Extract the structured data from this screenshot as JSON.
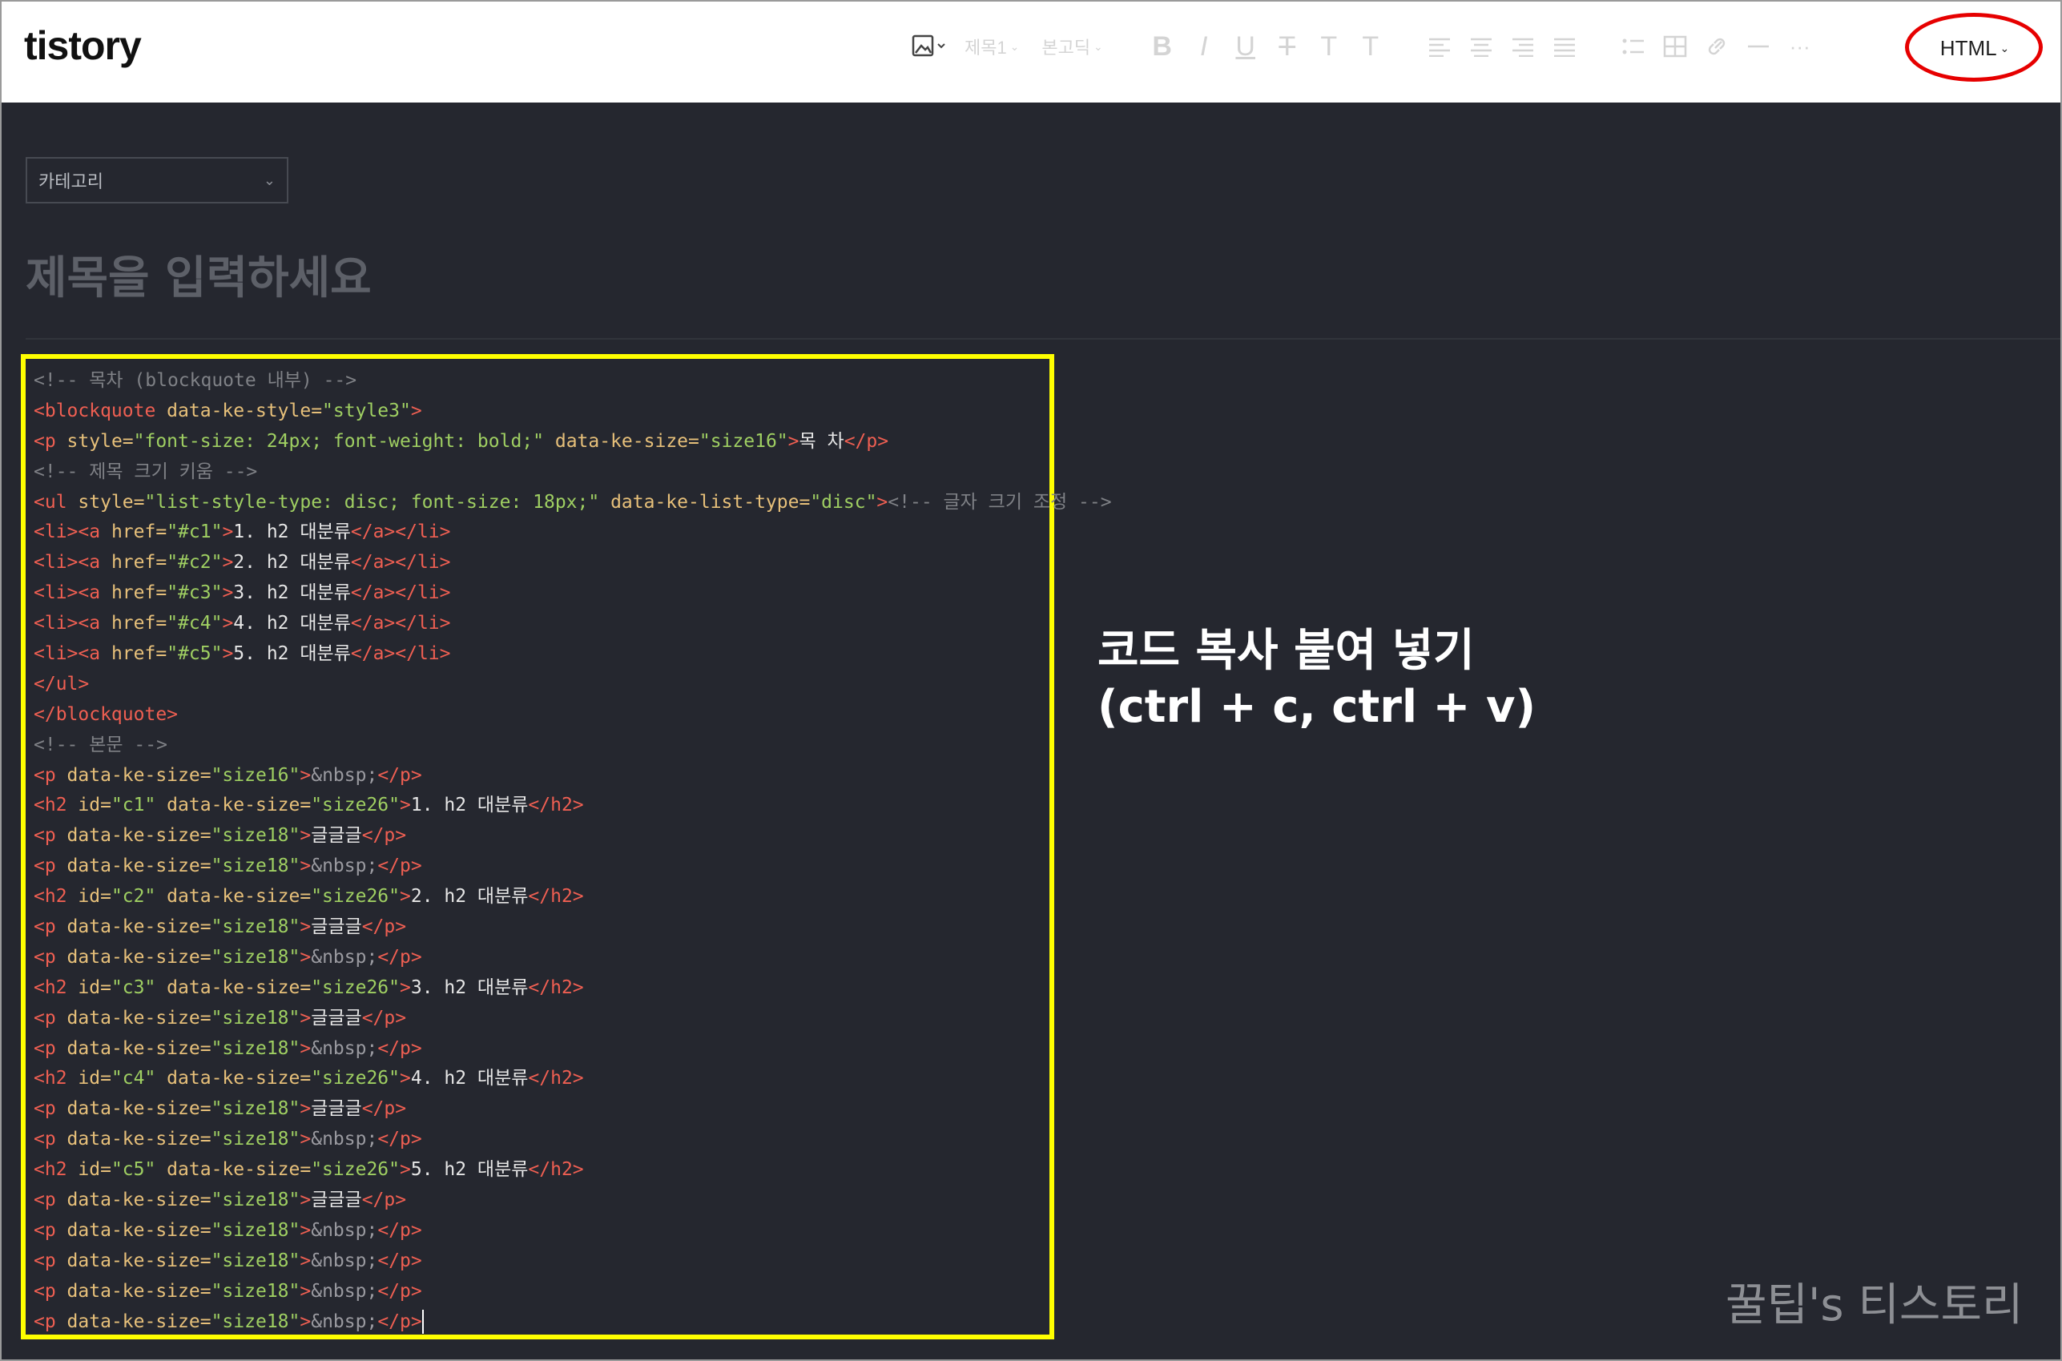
{
  "app": {
    "logo": "tistory"
  },
  "toolbar": {
    "heading_select": "제목1",
    "font_select": "본고딕",
    "bold": "B",
    "italic": "I",
    "underline": "U",
    "strike": "T",
    "text_color": "T",
    "bg_color": "T",
    "more": "···",
    "mode_button": "HTML",
    "icons": [
      "image-icon",
      "align-left-icon",
      "align-center-icon",
      "align-right-icon",
      "align-justify-icon",
      "list-icon",
      "table-icon",
      "link-icon",
      "divider-icon"
    ]
  },
  "editor": {
    "category_select": "카테고리",
    "title_placeholder": "제목을 입력하세요",
    "code_lines": [
      [
        {
          "t": "<!-- 목차 (blockquote 내부) -->",
          "c": "cm"
        }
      ],
      [
        {
          "t": "<blockquote",
          "c": "tg"
        },
        {
          "t": " data-ke-style=",
          "c": "at"
        },
        {
          "t": "\"style3\"",
          "c": "st"
        },
        {
          "t": ">",
          "c": "tg"
        }
      ],
      [
        {
          "t": "<p",
          "c": "tg"
        },
        {
          "t": " style=",
          "c": "at"
        },
        {
          "t": "\"font-size: 24px; font-weight: bold;\"",
          "c": "st"
        },
        {
          "t": " data-ke-size=",
          "c": "at"
        },
        {
          "t": "\"size16\"",
          "c": "st"
        },
        {
          "t": ">",
          "c": "tg"
        },
        {
          "t": "목 차",
          "c": "tx"
        },
        {
          "t": "</p>",
          "c": "tg"
        }
      ],
      [
        {
          "t": "<!-- 제목 크기 키움 -->",
          "c": "cm"
        }
      ],
      [
        {
          "t": "<ul",
          "c": "tg"
        },
        {
          "t": " style=",
          "c": "at"
        },
        {
          "t": "\"list-style-type: disc; font-size: 18px;\"",
          "c": "st"
        },
        {
          "t": " data-ke-list-type=",
          "c": "at"
        },
        {
          "t": "\"disc\"",
          "c": "st"
        },
        {
          "t": ">",
          "c": "tg"
        },
        {
          "t": "<!-- 글자 크기 조정 -->",
          "c": "cm"
        }
      ],
      [
        {
          "t": "<li><a",
          "c": "tg"
        },
        {
          "t": " href=",
          "c": "at"
        },
        {
          "t": "\"#c1\"",
          "c": "st"
        },
        {
          "t": ">",
          "c": "tg"
        },
        {
          "t": "1. h2 대분류",
          "c": "tx"
        },
        {
          "t": "</a></li>",
          "c": "tg"
        }
      ],
      [
        {
          "t": "<li><a",
          "c": "tg"
        },
        {
          "t": " href=",
          "c": "at"
        },
        {
          "t": "\"#c2\"",
          "c": "st"
        },
        {
          "t": ">",
          "c": "tg"
        },
        {
          "t": "2. h2 대분류",
          "c": "tx"
        },
        {
          "t": "</a></li>",
          "c": "tg"
        }
      ],
      [
        {
          "t": "<li><a",
          "c": "tg"
        },
        {
          "t": " href=",
          "c": "at"
        },
        {
          "t": "\"#c3\"",
          "c": "st"
        },
        {
          "t": ">",
          "c": "tg"
        },
        {
          "t": "3. h2 대분류",
          "c": "tx"
        },
        {
          "t": "</a></li>",
          "c": "tg"
        }
      ],
      [
        {
          "t": "<li><a",
          "c": "tg"
        },
        {
          "t": " href=",
          "c": "at"
        },
        {
          "t": "\"#c4\"",
          "c": "st"
        },
        {
          "t": ">",
          "c": "tg"
        },
        {
          "t": "4. h2 대분류",
          "c": "tx"
        },
        {
          "t": "</a></li>",
          "c": "tg"
        }
      ],
      [
        {
          "t": "<li><a",
          "c": "tg"
        },
        {
          "t": " href=",
          "c": "at"
        },
        {
          "t": "\"#c5\"",
          "c": "st"
        },
        {
          "t": ">",
          "c": "tg"
        },
        {
          "t": "5. h2 대분류",
          "c": "tx"
        },
        {
          "t": "</a></li>",
          "c": "tg"
        }
      ],
      [
        {
          "t": "</ul>",
          "c": "tg"
        }
      ],
      [
        {
          "t": "</blockquote>",
          "c": "tg"
        }
      ],
      [
        {
          "t": "<!-- 본문 -->",
          "c": "cm"
        }
      ],
      [
        {
          "t": "<p",
          "c": "tg"
        },
        {
          "t": " data-ke-size=",
          "c": "at"
        },
        {
          "t": "\"size16\"",
          "c": "st"
        },
        {
          "t": ">",
          "c": "tg"
        },
        {
          "t": "&nbsp;",
          "c": "en"
        },
        {
          "t": "</p>",
          "c": "tg"
        }
      ],
      [
        {
          "t": "<h2",
          "c": "tg"
        },
        {
          "t": " id=",
          "c": "at"
        },
        {
          "t": "\"c1\"",
          "c": "st"
        },
        {
          "t": " data-ke-size=",
          "c": "at"
        },
        {
          "t": "\"size26\"",
          "c": "st"
        },
        {
          "t": ">",
          "c": "tg"
        },
        {
          "t": "1. h2 대분류",
          "c": "tx"
        },
        {
          "t": "</h2>",
          "c": "tg"
        }
      ],
      [
        {
          "t": "<p",
          "c": "tg"
        },
        {
          "t": " data-ke-size=",
          "c": "at"
        },
        {
          "t": "\"size18\"",
          "c": "st"
        },
        {
          "t": ">",
          "c": "tg"
        },
        {
          "t": "글글글",
          "c": "tx"
        },
        {
          "t": "</p>",
          "c": "tg"
        }
      ],
      [
        {
          "t": "<p",
          "c": "tg"
        },
        {
          "t": " data-ke-size=",
          "c": "at"
        },
        {
          "t": "\"size18\"",
          "c": "st"
        },
        {
          "t": ">",
          "c": "tg"
        },
        {
          "t": "&nbsp;",
          "c": "en"
        },
        {
          "t": "</p>",
          "c": "tg"
        }
      ],
      [
        {
          "t": "<h2",
          "c": "tg"
        },
        {
          "t": " id=",
          "c": "at"
        },
        {
          "t": "\"c2\"",
          "c": "st"
        },
        {
          "t": " data-ke-size=",
          "c": "at"
        },
        {
          "t": "\"size26\"",
          "c": "st"
        },
        {
          "t": ">",
          "c": "tg"
        },
        {
          "t": "2. h2 대분류",
          "c": "tx"
        },
        {
          "t": "</h2>",
          "c": "tg"
        }
      ],
      [
        {
          "t": "<p",
          "c": "tg"
        },
        {
          "t": " data-ke-size=",
          "c": "at"
        },
        {
          "t": "\"size18\"",
          "c": "st"
        },
        {
          "t": ">",
          "c": "tg"
        },
        {
          "t": "글글글",
          "c": "tx"
        },
        {
          "t": "</p>",
          "c": "tg"
        }
      ],
      [
        {
          "t": "<p",
          "c": "tg"
        },
        {
          "t": " data-ke-size=",
          "c": "at"
        },
        {
          "t": "\"size18\"",
          "c": "st"
        },
        {
          "t": ">",
          "c": "tg"
        },
        {
          "t": "&nbsp;",
          "c": "en"
        },
        {
          "t": "</p>",
          "c": "tg"
        }
      ],
      [
        {
          "t": "<h2",
          "c": "tg"
        },
        {
          "t": " id=",
          "c": "at"
        },
        {
          "t": "\"c3\"",
          "c": "st"
        },
        {
          "t": " data-ke-size=",
          "c": "at"
        },
        {
          "t": "\"size26\"",
          "c": "st"
        },
        {
          "t": ">",
          "c": "tg"
        },
        {
          "t": "3. h2 대분류",
          "c": "tx"
        },
        {
          "t": "</h2>",
          "c": "tg"
        }
      ],
      [
        {
          "t": "<p",
          "c": "tg"
        },
        {
          "t": " data-ke-size=",
          "c": "at"
        },
        {
          "t": "\"size18\"",
          "c": "st"
        },
        {
          "t": ">",
          "c": "tg"
        },
        {
          "t": "글글글",
          "c": "tx"
        },
        {
          "t": "</p>",
          "c": "tg"
        }
      ],
      [
        {
          "t": "<p",
          "c": "tg"
        },
        {
          "t": " data-ke-size=",
          "c": "at"
        },
        {
          "t": "\"size18\"",
          "c": "st"
        },
        {
          "t": ">",
          "c": "tg"
        },
        {
          "t": "&nbsp;",
          "c": "en"
        },
        {
          "t": "</p>",
          "c": "tg"
        }
      ],
      [
        {
          "t": "<h2",
          "c": "tg"
        },
        {
          "t": " id=",
          "c": "at"
        },
        {
          "t": "\"c4\"",
          "c": "st"
        },
        {
          "t": " data-ke-size=",
          "c": "at"
        },
        {
          "t": "\"size26\"",
          "c": "st"
        },
        {
          "t": ">",
          "c": "tg"
        },
        {
          "t": "4. h2 대분류",
          "c": "tx"
        },
        {
          "t": "</h2>",
          "c": "tg"
        }
      ],
      [
        {
          "t": "<p",
          "c": "tg"
        },
        {
          "t": " data-ke-size=",
          "c": "at"
        },
        {
          "t": "\"size18\"",
          "c": "st"
        },
        {
          "t": ">",
          "c": "tg"
        },
        {
          "t": "글글글",
          "c": "tx"
        },
        {
          "t": "</p>",
          "c": "tg"
        }
      ],
      [
        {
          "t": "<p",
          "c": "tg"
        },
        {
          "t": " data-ke-size=",
          "c": "at"
        },
        {
          "t": "\"size18\"",
          "c": "st"
        },
        {
          "t": ">",
          "c": "tg"
        },
        {
          "t": "&nbsp;",
          "c": "en"
        },
        {
          "t": "</p>",
          "c": "tg"
        }
      ],
      [
        {
          "t": "<h2",
          "c": "tg"
        },
        {
          "t": " id=",
          "c": "at"
        },
        {
          "t": "\"c5\"",
          "c": "st"
        },
        {
          "t": " data-ke-size=",
          "c": "at"
        },
        {
          "t": "\"size26\"",
          "c": "st"
        },
        {
          "t": ">",
          "c": "tg"
        },
        {
          "t": "5. h2 대분류",
          "c": "tx"
        },
        {
          "t": "</h2>",
          "c": "tg"
        }
      ],
      [
        {
          "t": "<p",
          "c": "tg"
        },
        {
          "t": " data-ke-size=",
          "c": "at"
        },
        {
          "t": "\"size18\"",
          "c": "st"
        },
        {
          "t": ">",
          "c": "tg"
        },
        {
          "t": "글글글",
          "c": "tx"
        },
        {
          "t": "</p>",
          "c": "tg"
        }
      ],
      [
        {
          "t": "<p",
          "c": "tg"
        },
        {
          "t": " data-ke-size=",
          "c": "at"
        },
        {
          "t": "\"size18\"",
          "c": "st"
        },
        {
          "t": ">",
          "c": "tg"
        },
        {
          "t": "&nbsp;",
          "c": "en"
        },
        {
          "t": "</p>",
          "c": "tg"
        }
      ],
      [
        {
          "t": "<p",
          "c": "tg"
        },
        {
          "t": " data-ke-size=",
          "c": "at"
        },
        {
          "t": "\"size18\"",
          "c": "st"
        },
        {
          "t": ">",
          "c": "tg"
        },
        {
          "t": "&nbsp;",
          "c": "en"
        },
        {
          "t": "</p>",
          "c": "tg"
        }
      ],
      [
        {
          "t": "<p",
          "c": "tg"
        },
        {
          "t": " data-ke-size=",
          "c": "at"
        },
        {
          "t": "\"size18\"",
          "c": "st"
        },
        {
          "t": ">",
          "c": "tg"
        },
        {
          "t": "&nbsp;",
          "c": "en"
        },
        {
          "t": "</p>",
          "c": "tg"
        }
      ],
      [
        {
          "t": "<p",
          "c": "tg"
        },
        {
          "t": " data-ke-size=",
          "c": "at"
        },
        {
          "t": "\"size18\"",
          "c": "st"
        },
        {
          "t": ">",
          "c": "tg"
        },
        {
          "t": "&nbsp;",
          "c": "en"
        },
        {
          "t": "</p>",
          "c": "tg"
        }
      ]
    ]
  },
  "annotation": {
    "line1": "코드 복사 붙여 넣기",
    "line2": "(ctrl + c, ctrl + v)"
  },
  "watermark": "꿀팁's 티스토리",
  "colors": {
    "editor_bg": "#25272f",
    "highlight_box": "#ffff00",
    "highlight_ring": "#e60000",
    "tag": "#ef5f52",
    "attr": "#e7c07a",
    "string": "#9fcf62",
    "comment": "#7f8186"
  }
}
